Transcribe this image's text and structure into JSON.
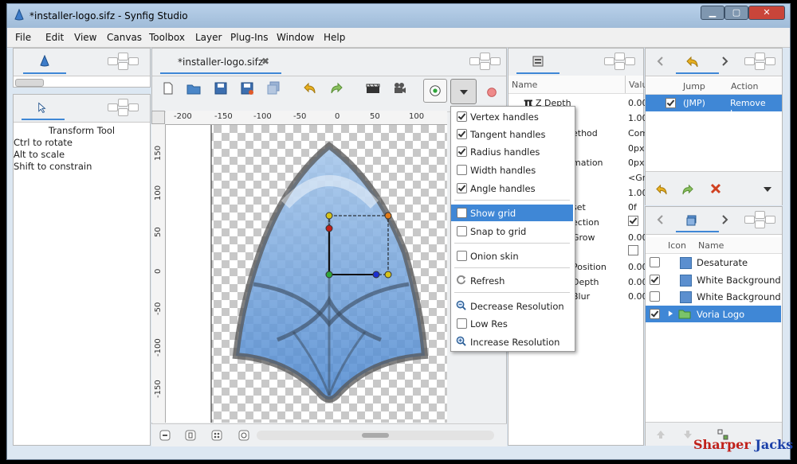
{
  "window": {
    "title": "*installer-logo.sifz - Synfig Studio",
    "min": "▁",
    "max": "▢",
    "close": "✕"
  },
  "menubar": [
    "File",
    "Edit",
    "View",
    "Canvas",
    "Toolbox",
    "Layer",
    "Plug-Ins",
    "Window",
    "Help"
  ],
  "tool_options": {
    "title": "Transform Tool",
    "lines": [
      "Ctrl to rotate",
      "Alt to scale",
      "Shift to constrain"
    ]
  },
  "canvas": {
    "tab_label": "*installer-logo.sifz",
    "tab_close": "✖"
  },
  "ruler": {
    "h_ticks": [
      "-200",
      "-150",
      "-100",
      "-50",
      "0",
      "50",
      "100"
    ],
    "v_ticks": [
      "150",
      "100",
      "50",
      "0",
      "-50",
      "-100",
      "-150"
    ]
  },
  "toolbar_icons": [
    "new-file-icon",
    "open-folder-icon",
    "save-icon",
    "save-as-icon",
    "save-all-icon",
    "undo-icon",
    "redo-icon",
    "render-icon",
    "preview-icon"
  ],
  "show_menu": {
    "items": [
      {
        "label": "Vertex handles",
        "checked": true
      },
      {
        "label": "Tangent handles",
        "checked": true
      },
      {
        "label": "Radius handles",
        "checked": true
      },
      {
        "label": "Width handles",
        "checked": false
      },
      {
        "label": "Angle handles",
        "checked": true
      },
      {
        "label": "Show grid",
        "checked": false,
        "highlight": true
      },
      {
        "label": "Snap to grid",
        "checked": false
      },
      {
        "label": "Onion skin",
        "checked": false
      },
      {
        "label": "Refresh"
      },
      {
        "label": "Decrease Resolution"
      },
      {
        "label": "Low Res",
        "checked": false
      },
      {
        "label": "Increase Resolution"
      }
    ]
  },
  "params": {
    "header_name": "Name",
    "header_value": "Valu",
    "rows": [
      {
        "name": "Z Depth",
        "value": "0.00",
        "prefix": "π"
      },
      {
        "name": "",
        "value": "1.00"
      },
      {
        "name": "ethod",
        "value": "Com"
      },
      {
        "name": "",
        "value": "0px,"
      },
      {
        "name": "mation",
        "value": "0px,"
      },
      {
        "name": "",
        "value": "<Gr"
      },
      {
        "name": "",
        "value": "1.00"
      },
      {
        "name": "set",
        "value": "0f"
      },
      {
        "name": "ection",
        "value": ""
      },
      {
        "name": "Grow",
        "value": "0.00"
      },
      {
        "name": "",
        "value": ""
      },
      {
        "name": "Position",
        "value": "0.00"
      },
      {
        "name": "Depth",
        "value": "0.00"
      },
      {
        "name": "Blur",
        "value": "0.00"
      }
    ]
  },
  "history": {
    "col_jump": "Jump",
    "col_action": "Action",
    "row_jump": "(JMP)",
    "row_action": "Remove Laye"
  },
  "layers": {
    "col_icon": "Icon",
    "col_name": "Name",
    "rows": [
      {
        "name": "Desaturate",
        "checked": false
      },
      {
        "name": "White Background",
        "checked": true
      },
      {
        "name": "White Background",
        "checked": false
      },
      {
        "name": "Voria Logo",
        "checked": true,
        "selected": true
      }
    ]
  },
  "watermark": {
    "part1": "Sharper",
    "part2": "Jacks"
  },
  "colors": {
    "accent": "#3f87d6",
    "panel_bg": "#eef0f2"
  }
}
